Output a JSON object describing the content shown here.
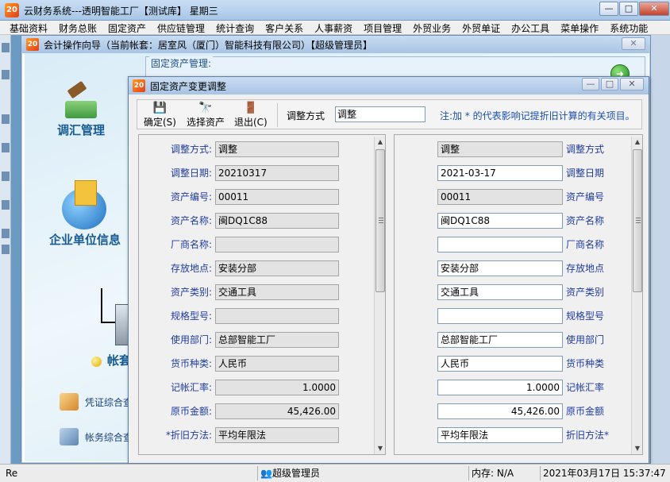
{
  "app": {
    "logo": "20",
    "title": "云财务系统---透明智能工厂【测试库】 星期三",
    "minimize": "—",
    "maximize": "□",
    "close": "✕"
  },
  "menubar": [
    "基础资料",
    "财务总账",
    "固定资产",
    "供应链管理",
    "统计查询",
    "客户关系",
    "人事薪资",
    "项目管理",
    "外贸业务",
    "外贸单证",
    "办公工具",
    "菜单操作",
    "系统功能"
  ],
  "wizard": {
    "logo": "20",
    "title": "会计操作向导（当前帐套：居室风（厦门）智能科技有限公司）【超级管理员】",
    "close": "✕",
    "fa_group_label": "固定资产管理:",
    "nav": {
      "adjust": "调汇管理",
      "company": "企业单位信息",
      "account": "帐套"
    },
    "links": {
      "voucher": "凭证综合查",
      "books": "帐务综合查"
    }
  },
  "dialog": {
    "logo": "20",
    "title": "固定资产变更调整",
    "toolbar": {
      "confirm": "确定(S)",
      "select": "选择资产",
      "exit": "退出(C)",
      "adjust_label": "调整方式",
      "adjust_value": "调整",
      "note": "注:加 * 的代表影响记提折旧计算的有关项目。"
    },
    "left_rows": [
      {
        "label": "调整方式:",
        "value": "调整"
      },
      {
        "label": "调整日期:",
        "value": "20210317"
      },
      {
        "label": "资产编号:",
        "value": "00011"
      },
      {
        "label": "资产名称:",
        "value": "闽DQ1C88"
      },
      {
        "label": "厂商名称:",
        "value": ""
      },
      {
        "label": "存放地点:",
        "value": "安装分部"
      },
      {
        "label": "资产类别:",
        "value": "交通工具"
      },
      {
        "label": "规格型号:",
        "value": ""
      },
      {
        "label": "使用部门:",
        "value": "总部智能工厂"
      },
      {
        "label": "货币种类:",
        "value": "人民币"
      },
      {
        "label": "记帐汇率:",
        "value": "1.0000"
      },
      {
        "label": "原币金额:",
        "value": "45,426.00"
      },
      {
        "label": "*折旧方法:",
        "value": "平均年限法"
      }
    ],
    "right_rows": [
      {
        "label": "调整方式",
        "value": "调整"
      },
      {
        "label": "调整日期",
        "value": "2021-03-17"
      },
      {
        "label": "资产编号",
        "value": "00011"
      },
      {
        "label": "资产名称",
        "value": "闽DQ1C88"
      },
      {
        "label": "厂商名称",
        "value": ""
      },
      {
        "label": "存放地点",
        "value": "安装分部"
      },
      {
        "label": "资产类别",
        "value": "交通工具"
      },
      {
        "label": "规格型号",
        "value": ""
      },
      {
        "label": "使用部门",
        "value": "总部智能工厂"
      },
      {
        "label": "货币种类",
        "value": "人民币"
      },
      {
        "label": "记帐汇率",
        "value": "1.0000"
      },
      {
        "label": "原币金额",
        "value": "45,426.00"
      },
      {
        "label": "折旧方法*",
        "value": "平均年限法"
      }
    ]
  },
  "status": {
    "left": "Re",
    "user": "超级管理员",
    "memory": "内存: N/A",
    "datetime": "2021年03月17日 15:37:47"
  },
  "colors": {
    "label_blue": "#1f3c9e",
    "nav_blue": "#185b92",
    "note_blue": "#1a4fb0"
  }
}
